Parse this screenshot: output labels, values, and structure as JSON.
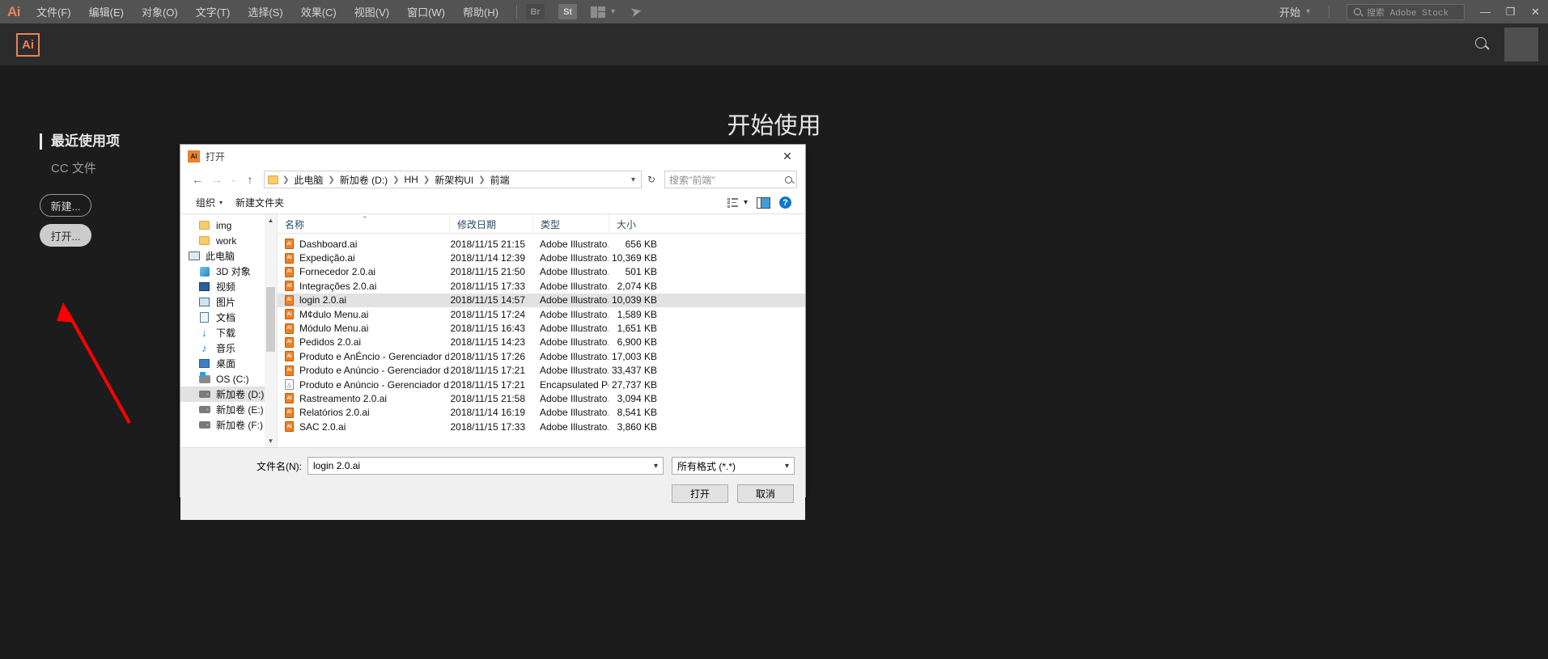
{
  "menubar": {
    "logo": "Ai",
    "items": [
      {
        "label": "文件(F)"
      },
      {
        "label": "编辑(E)"
      },
      {
        "label": "对象(O)"
      },
      {
        "label": "文字(T)"
      },
      {
        "label": "选择(S)"
      },
      {
        "label": "效果(C)"
      },
      {
        "label": "视图(V)"
      },
      {
        "label": "窗口(W)"
      },
      {
        "label": "帮助(H)"
      }
    ],
    "bridge_badge": "Br",
    "stock_badge": "St",
    "layout_icon": "layout-switcher-icon",
    "rocket_icon": "rocket-icon",
    "start_label": "开始",
    "stock_search_placeholder": "搜索 Adobe Stock",
    "window_minimize": "—",
    "window_restore": "❐",
    "window_close": "✕"
  },
  "workspace": {
    "title": "开始使用",
    "sidebar": {
      "heading": "最近使用项",
      "sub_item": "CC 文件"
    },
    "new_button": "新建...",
    "open_button": "打开...",
    "annotation_color": "#ff0000"
  },
  "dialog": {
    "title": "打开",
    "app_icon": "Ai",
    "close": "✕",
    "nav": {
      "back": "←",
      "forward": "→",
      "recent": "⌄",
      "up": "↑"
    },
    "breadcrumb": [
      "此电脑",
      "新加卷 (D:)",
      "HH",
      "新架构UI",
      "前端"
    ],
    "refresh": "↻",
    "search_placeholder": "搜索\"前端\"",
    "commands": {
      "organize": "组织",
      "new_folder": "新建文件夹"
    },
    "toolbar_icons": {
      "view_options": "view-options-icon",
      "preview_pane": "preview-pane-icon",
      "help": "?"
    },
    "tree": [
      {
        "label": "img",
        "icon": "folder-icon",
        "indent": 1,
        "selected": false
      },
      {
        "label": "work",
        "icon": "folder-icon",
        "indent": 1,
        "selected": false
      },
      {
        "label": "此电脑",
        "icon": "computer-icon",
        "indent": 0,
        "selected": false
      },
      {
        "label": "3D 对象",
        "icon": "3d-objects-icon",
        "indent": 1,
        "selected": false
      },
      {
        "label": "视频",
        "icon": "videos-icon",
        "indent": 1,
        "selected": false
      },
      {
        "label": "图片",
        "icon": "pictures-icon",
        "indent": 1,
        "selected": false
      },
      {
        "label": "文档",
        "icon": "documents-icon",
        "indent": 1,
        "selected": false
      },
      {
        "label": "下载",
        "icon": "downloads-icon",
        "indent": 1,
        "selected": false
      },
      {
        "label": "音乐",
        "icon": "music-icon",
        "indent": 1,
        "selected": false
      },
      {
        "label": "桌面",
        "icon": "desktop-icon",
        "indent": 1,
        "selected": false
      },
      {
        "label": "OS (C:)",
        "icon": "os-drive-icon",
        "indent": 1,
        "selected": false
      },
      {
        "label": "新加卷 (D:)",
        "icon": "drive-icon",
        "indent": 1,
        "selected": true
      },
      {
        "label": "新加卷 (E:)",
        "icon": "drive-icon",
        "indent": 1,
        "selected": false
      },
      {
        "label": "新加卷 (F:)",
        "icon": "drive-icon",
        "indent": 1,
        "selected": false
      }
    ],
    "columns": [
      {
        "label": "名称",
        "sorted": "asc"
      },
      {
        "label": "修改日期",
        "sorted": ""
      },
      {
        "label": "类型",
        "sorted": ""
      },
      {
        "label": "大小",
        "sorted": ""
      }
    ],
    "sort_caret": "⌃",
    "files": [
      {
        "name": "Dashboard.ai",
        "date": "2018/11/15 21:15",
        "type": "Adobe Illustrato...",
        "size": "656 KB",
        "icon": "ai-file-icon",
        "selected": false
      },
      {
        "name": "Expedição.ai",
        "date": "2018/11/14 12:39",
        "type": "Adobe Illustrato...",
        "size": "10,369 KB",
        "icon": "ai-file-icon",
        "selected": false
      },
      {
        "name": "Fornecedor 2.0.ai",
        "date": "2018/11/15 21:50",
        "type": "Adobe Illustrato...",
        "size": "501 KB",
        "icon": "ai-file-icon",
        "selected": false
      },
      {
        "name": "Integrações 2.0.ai",
        "date": "2018/11/15 17:33",
        "type": "Adobe Illustrato...",
        "size": "2,074 KB",
        "icon": "ai-file-icon",
        "selected": false
      },
      {
        "name": "login 2.0.ai",
        "date": "2018/11/15 14:57",
        "type": "Adobe Illustrato...",
        "size": "10,039 KB",
        "icon": "ai-file-icon",
        "selected": true
      },
      {
        "name": "M¢dulo Menu.ai",
        "date": "2018/11/15 17:24",
        "type": "Adobe Illustrato...",
        "size": "1,589 KB",
        "icon": "ai-file-icon",
        "selected": false
      },
      {
        "name": "Módulo Menu.ai",
        "date": "2018/11/15 16:43",
        "type": "Adobe Illustrato...",
        "size": "1,651 KB",
        "icon": "ai-file-icon",
        "selected": false
      },
      {
        "name": "Pedidos 2.0.ai",
        "date": "2018/11/15 14:23",
        "type": "Adobe Illustrato...",
        "size": "6,900 KB",
        "icon": "ai-file-icon",
        "selected": false
      },
      {
        "name": "Produto e AnÉncio - Gerenciador de ...",
        "date": "2018/11/15 17:26",
        "type": "Adobe Illustrato...",
        "size": "17,003 KB",
        "icon": "ai-file-icon",
        "selected": false
      },
      {
        "name": "Produto e Anúncio - Gerenciador de ...",
        "date": "2018/11/15 17:21",
        "type": "Adobe Illustrato...",
        "size": "33,437 KB",
        "icon": "ai-file-icon",
        "selected": false
      },
      {
        "name": "Produto e Anúncio - Gerenciador de ...",
        "date": "2018/11/15 17:21",
        "type": "Encapsulated Po...",
        "size": "27,737 KB",
        "icon": "eps-file-icon",
        "selected": false
      },
      {
        "name": "Rastreamento 2.0.ai",
        "date": "2018/11/15 21:58",
        "type": "Adobe Illustrato...",
        "size": "3,094 KB",
        "icon": "ai-file-icon",
        "selected": false
      },
      {
        "name": "Relatórios 2.0.ai",
        "date": "2018/11/14 16:19",
        "type": "Adobe Illustrato...",
        "size": "8,541 KB",
        "icon": "ai-file-icon",
        "selected": false
      },
      {
        "name": "SAC 2.0.ai",
        "date": "2018/11/15 17:33",
        "type": "Adobe Illustrato...",
        "size": "3,860 KB",
        "icon": "ai-file-icon",
        "selected": false
      }
    ],
    "footer": {
      "filename_label": "文件名(N):",
      "filename_value": "login 2.0.ai",
      "filter_value": "所有格式 (*.*)",
      "open_button": "打开",
      "cancel_button": "取消"
    }
  }
}
